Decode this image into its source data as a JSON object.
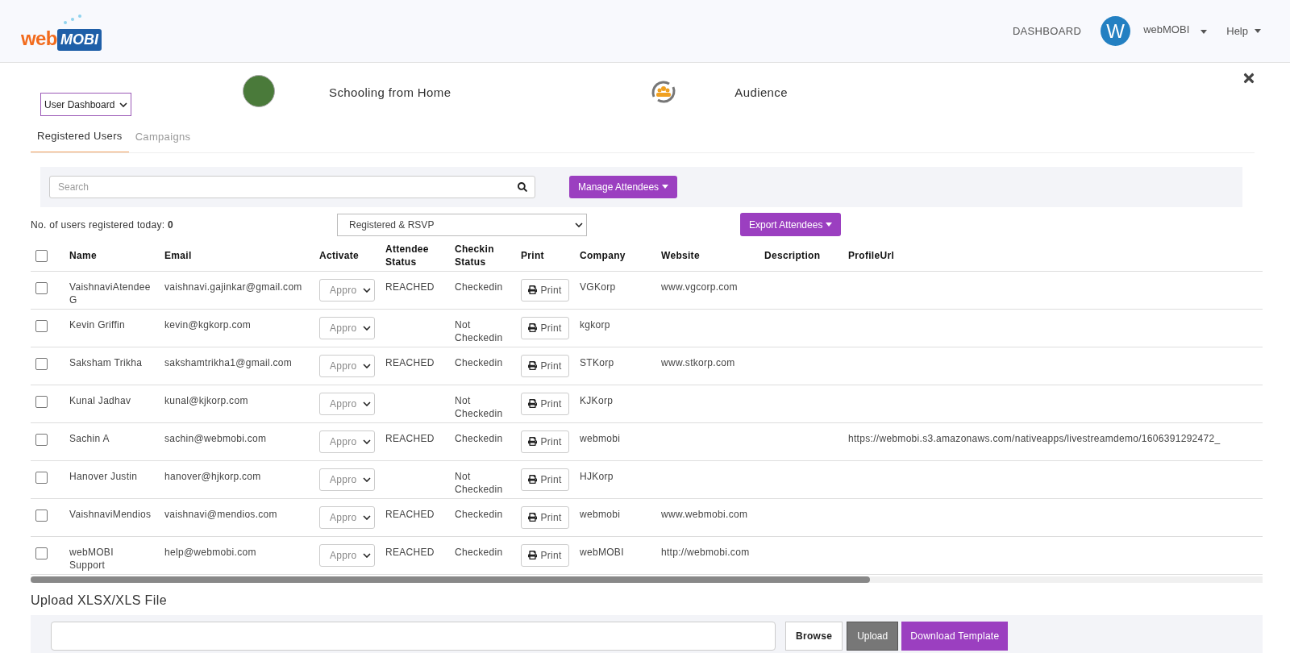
{
  "header": {
    "logo_parts": [
      "web",
      "MOBI"
    ],
    "nav": "DASHBOARD",
    "avatar_letter": "W",
    "user": "webMOBI",
    "help": "Help"
  },
  "top": {
    "view_select": "User Dashboard",
    "event_name": "Schooling from Home",
    "section_name": "Audience"
  },
  "tabs": [
    {
      "label": "Registered Users",
      "selected": true
    },
    {
      "label": "Campaigns",
      "selected": false
    }
  ],
  "search": {
    "placeholder": "Search"
  },
  "manage_button": "Manage Attendees",
  "registered_today": {
    "label": "No. of users registered today:",
    "value": "0"
  },
  "filter_select": "Registered & RSVP",
  "export_button": "Export Attendees",
  "table": {
    "select_all_checked": false,
    "columns": [
      "Name",
      "Email",
      "Activate",
      "Attendee Status",
      "Checkin Status",
      "Print",
      "Company",
      "Website",
      "Description",
      "ProfileUrl"
    ],
    "rows": [
      {
        "checked": false,
        "name": "VaishnaviAtendee G",
        "email": "vaishnavi.gajinkar@gmail.com",
        "activate": "Appro",
        "attendee_status": "REACHED",
        "checkin_status": "Checkedin",
        "print": "Print",
        "company": "VGKorp",
        "website": "www.vgcorp.com",
        "profile_url": ""
      },
      {
        "checked": false,
        "name": "Kevin Griffin",
        "email": "kevin@kgkorp.com",
        "activate": "Appro",
        "attendee_status": "",
        "checkin_status": "Not Checkedin",
        "print": "Print",
        "company": "kgkorp",
        "website": "",
        "profile_url": ""
      },
      {
        "checked": false,
        "name": "Saksham Trikha",
        "email": "sakshamtrikha1@gmail.com",
        "activate": "Appro",
        "attendee_status": "REACHED",
        "checkin_status": "Checkedin",
        "print": "Print",
        "company": "STKorp",
        "website": "www.stkorp.com",
        "profile_url": ""
      },
      {
        "checked": false,
        "name": "Kunal Jadhav",
        "email": "kunal@kjkorp.com",
        "activate": "Appro",
        "attendee_status": "",
        "checkin_status": "Not Checkedin",
        "print": "Print",
        "company": "KJKorp",
        "website": "",
        "profile_url": ""
      },
      {
        "checked": false,
        "name": "Sachin A",
        "email": "sachin@webmobi.com",
        "activate": "Appro",
        "attendee_status": "REACHED",
        "checkin_status": "Checkedin",
        "print": "Print",
        "company": "webmobi",
        "website": "",
        "profile_url": "https://webmobi.s3.amazonaws.com/nativeapps/livestreamdemo/1606391292472_"
      },
      {
        "checked": false,
        "name": "Hanover Justin",
        "email": "hanover@hjkorp.com",
        "activate": "Appro",
        "attendee_status": "",
        "checkin_status": "Not Checkedin",
        "print": "Print",
        "company": "HJKorp",
        "website": "",
        "profile_url": ""
      },
      {
        "checked": false,
        "name": "VaishnaviMendios",
        "email": "vaishnavi@mendios.com",
        "activate": "Appro",
        "attendee_status": "REACHED",
        "checkin_status": "Checkedin",
        "print": "Print",
        "company": "webmobi",
        "website": "www.webmobi.com",
        "profile_url": ""
      },
      {
        "checked": false,
        "name": "webMOBI Support",
        "email": "help@webmobi.com",
        "activate": "Appro",
        "attendee_status": "REACHED",
        "checkin_status": "Checkedin",
        "print": "Print",
        "company": "webMOBI",
        "website": "http://webmobi.com",
        "profile_url": ""
      }
    ]
  },
  "upload": {
    "title": "Upload XLSX/XLS File",
    "browse": "Browse",
    "upload": "Upload",
    "download": "Download Template"
  }
}
